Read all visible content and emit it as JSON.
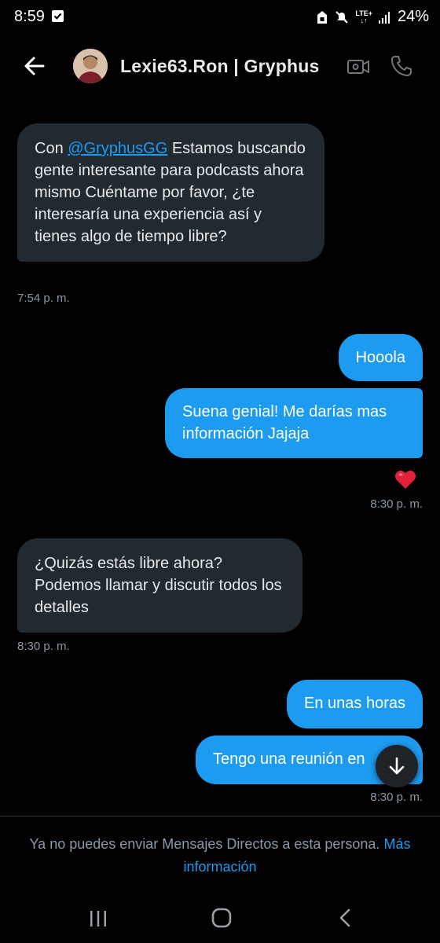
{
  "status_bar": {
    "time": "8:59",
    "network_top": "LTE+",
    "battery": "24%"
  },
  "header": {
    "title": "Lexie63.Ron | Gryphus"
  },
  "messages": [
    {
      "dir": "in",
      "pre": "Con ",
      "mention": "@GryphusGG",
      "rest": " Estamos buscando gente interesante para podcasts ahora mismo Cuéntame por favor, ¿te interesaría una experiencia así y tienes algo de tiempo libre?"
    },
    {
      "dir": "out",
      "text": "Hooola"
    },
    {
      "dir": "out",
      "text": "Suena genial! Me darías mas información Jajaja",
      "reaction": "heart"
    },
    {
      "dir": "in",
      "text": "¿Quizás estás libre ahora? Podemos llamar y discutir todos los detalles"
    },
    {
      "dir": "out",
      "text": "En unas horas"
    },
    {
      "dir": "out",
      "text": "Tengo una reunión en"
    }
  ],
  "timestamps": [
    "7:54 p. m.",
    "8:30 p. m.",
    "8:30 p. m.",
    "8:30 p. m."
  ],
  "footer": {
    "notice": "Ya no puedes enviar Mensajes Directos a esta persona.",
    "more_link": "Más información"
  },
  "colors": {
    "outgoing": "#1d9bf0",
    "incoming": "#222a31",
    "background": "#000000",
    "timestamp": "#8b98a5"
  },
  "icons": [
    "back-arrow-icon",
    "video-call-icon",
    "phone-icon",
    "heart-icon",
    "arrow-down-icon",
    "recents-icon",
    "home-icon",
    "nav-back-icon"
  ]
}
